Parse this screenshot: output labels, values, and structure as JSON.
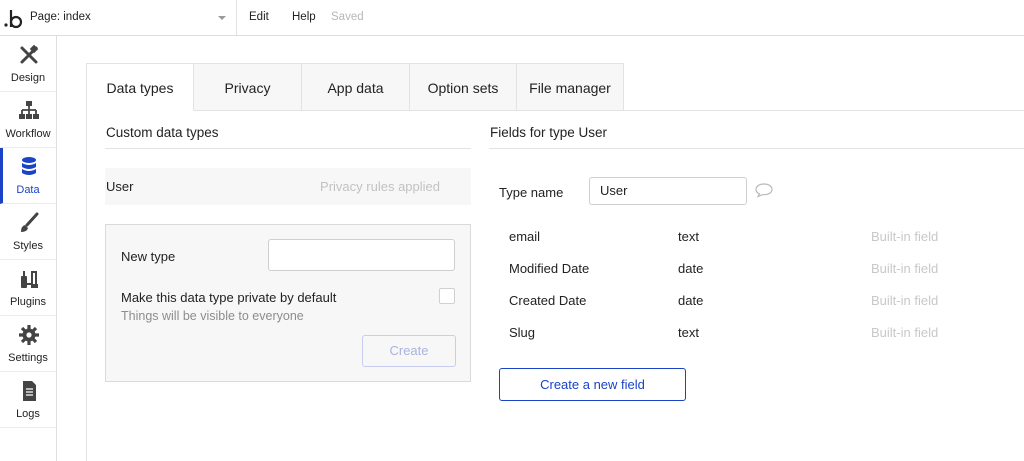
{
  "topbar": {
    "page_label": "Page: index",
    "menu": {
      "edit": "Edit",
      "help": "Help",
      "saved": "Saved"
    }
  },
  "sidebar": {
    "items": [
      {
        "label": "Design",
        "icon": "design-icon",
        "active": false
      },
      {
        "label": "Workflow",
        "icon": "workflow-icon",
        "active": false
      },
      {
        "label": "Data",
        "icon": "database-icon",
        "active": true
      },
      {
        "label": "Styles",
        "icon": "brush-icon",
        "active": false
      },
      {
        "label": "Plugins",
        "icon": "plug-icon",
        "active": false
      },
      {
        "label": "Settings",
        "icon": "gear-icon",
        "active": false
      },
      {
        "label": "Logs",
        "icon": "document-icon",
        "active": false
      }
    ],
    "accent": "#1a43c8"
  },
  "tabs": [
    {
      "label": "Data types",
      "active": true
    },
    {
      "label": "Privacy",
      "active": false
    },
    {
      "label": "App data",
      "active": false
    },
    {
      "label": "Option sets",
      "active": false
    },
    {
      "label": "File manager",
      "active": false
    }
  ],
  "custom_types": {
    "title": "Custom data types",
    "types": [
      {
        "name": "User",
        "status": "Privacy rules applied"
      }
    ],
    "new_type": {
      "label": "New type",
      "value": "",
      "private_label": "Make this data type private by default",
      "private_sub": "Things will be visible to everyone",
      "private_checked": false,
      "create_label": "Create"
    }
  },
  "fields": {
    "title": "Fields for type User",
    "type_name_label": "Type name",
    "type_name_value": "User",
    "rows": [
      {
        "name": "email",
        "type": "text",
        "tag": "Built-in field"
      },
      {
        "name": "Modified Date",
        "type": "date",
        "tag": "Built-in field"
      },
      {
        "name": "Created Date",
        "type": "date",
        "tag": "Built-in field"
      },
      {
        "name": "Slug",
        "type": "text",
        "tag": "Built-in field"
      }
    ],
    "new_field_label": "Create a new field"
  }
}
